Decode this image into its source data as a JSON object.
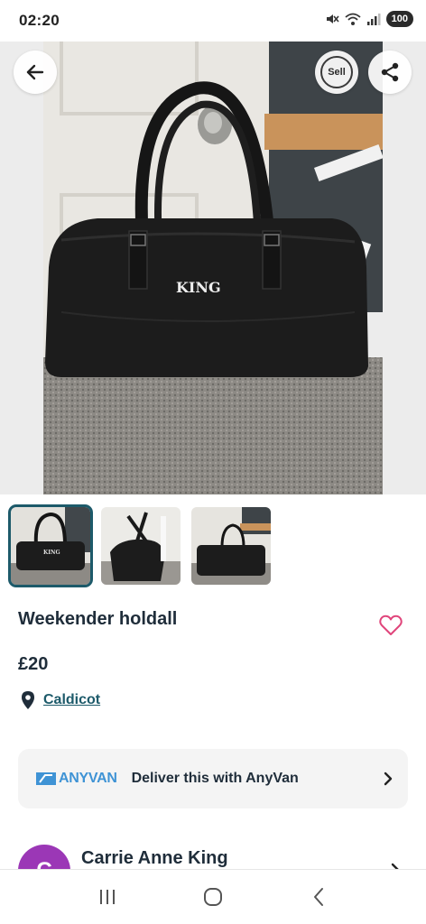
{
  "status_bar": {
    "time": "02:20",
    "battery": "100",
    "icons": [
      "mute-icon",
      "wifi-icon",
      "signal-icon"
    ]
  },
  "hero": {
    "product_text": "KING",
    "buttons": {
      "back": "arrow-left-icon",
      "sell": "Sell",
      "share": "share-icon"
    }
  },
  "thumbnails": {
    "count": 3,
    "selected_index": 0
  },
  "listing": {
    "title": "Weekender holdall",
    "price": "£20",
    "location": "Caldicot"
  },
  "delivery": {
    "logo": "ANYVAN",
    "text": "Deliver this with AnyVan"
  },
  "seller": {
    "initial": "C",
    "name": "Carrie Anne King"
  },
  "colors": {
    "accent": "#1d5a6a",
    "heart": "#e0457b",
    "anyvan_blue": "#3f93d5",
    "avatar": "#9b37b6"
  }
}
